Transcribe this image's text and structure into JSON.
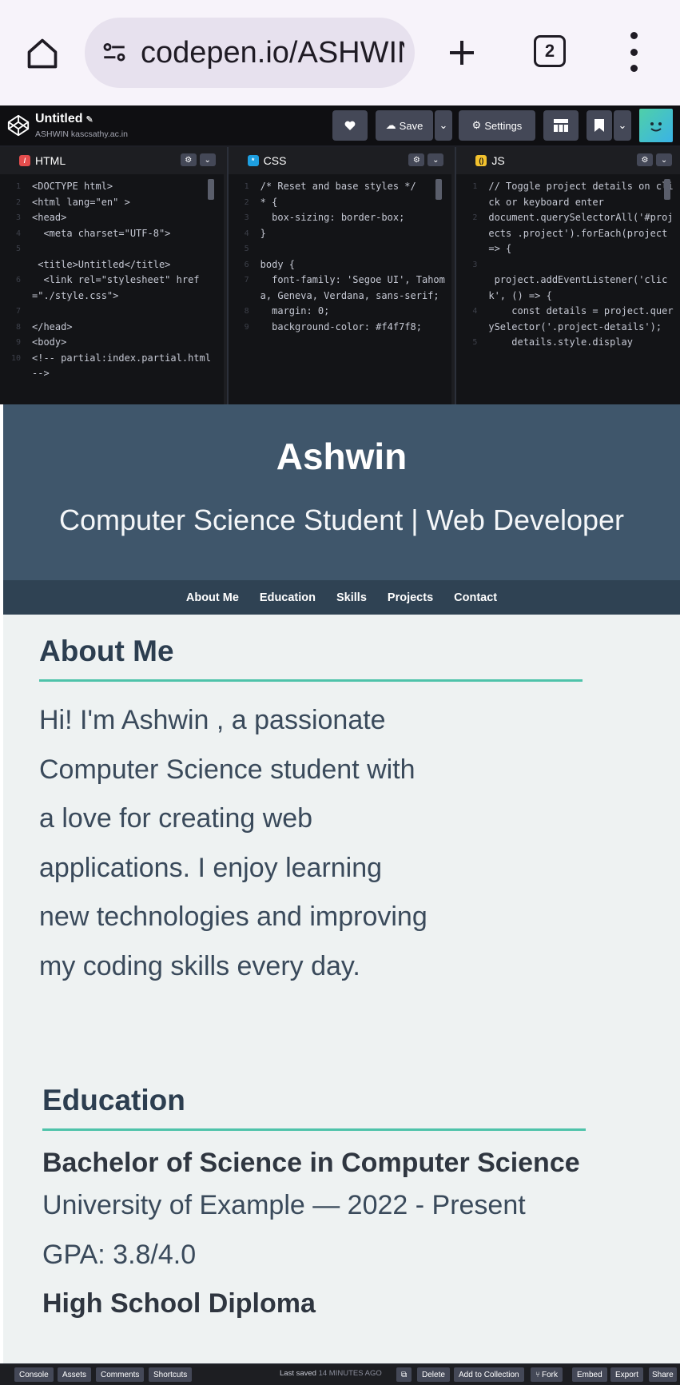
{
  "browser": {
    "url": "codepen.io/ASHWIN·",
    "tab_count": "2"
  },
  "codepen": {
    "pen_title": "Untitled",
    "user": "ASHWIN kascsathy.ac.in",
    "save_label": "Save",
    "settings_label": "Settings",
    "footer": {
      "console": "Console",
      "assets": "Assets",
      "comments": "Comments",
      "shortcuts": "Shortcuts",
      "last_saved": "Last saved",
      "last_saved_time": "14 MINUTES AGO",
      "delete": "Delete",
      "add_to_collection": "Add to Collection",
      "fork": "Fork",
      "embed": "Embed",
      "export": "Export",
      "share": "Share"
    }
  },
  "editors": {
    "html": {
      "label": "HTML",
      "lines": [
        {
          "n": "1",
          "t": "<DOCTYPE html>"
        },
        {
          "n": "2",
          "t": "<html lang=\"en\" >"
        },
        {
          "n": "3",
          "t": "<head>"
        },
        {
          "n": "4",
          "t": "  <meta charset=\"UTF-8\">"
        },
        {
          "n": "5",
          "t": ""
        },
        {
          "n": "",
          "t": " <title>Untitled</title>"
        },
        {
          "n": "6",
          "t": "  <link rel=\"stylesheet\" href=\"./style.css\">"
        },
        {
          "n": "7",
          "t": ""
        },
        {
          "n": "8",
          "t": "</head>"
        },
        {
          "n": "9",
          "t": "<body>"
        },
        {
          "n": "10",
          "t": "<!-- partial:index.partial.html -->"
        }
      ]
    },
    "css": {
      "label": "CSS",
      "lines": [
        {
          "n": "1",
          "t": "/* Reset and base styles */"
        },
        {
          "n": "2",
          "t": "* {"
        },
        {
          "n": "3",
          "t": "  box-sizing: border-box;"
        },
        {
          "n": "4",
          "t": "}"
        },
        {
          "n": "5",
          "t": ""
        },
        {
          "n": "6",
          "t": "body {"
        },
        {
          "n": "7",
          "t": "  font-family: 'Segoe UI', Tahoma, Geneva, Verdana, sans-serif;"
        },
        {
          "n": "8",
          "t": "  margin: 0;"
        },
        {
          "n": "9",
          "t": "  background-color: #f4f7f8;"
        }
      ]
    },
    "js": {
      "label": "JS",
      "lines": [
        {
          "n": "1",
          "t": "// Toggle project details on click or keyboard enter"
        },
        {
          "n": "2",
          "t": "document.querySelectorAll('#projects .project').forEach(project => {"
        },
        {
          "n": "3",
          "t": ""
        },
        {
          "n": "",
          "t": " project.addEventListener('click', () => {"
        },
        {
          "n": "4",
          "t": "    const details = project.querySelector('.project-details');"
        },
        {
          "n": "5",
          "t": "    details.style.display"
        }
      ]
    }
  },
  "site": {
    "name": "Ashwin",
    "tagline": "Computer Science Student | Web Developer",
    "nav": [
      "About Me",
      "Education",
      "Skills",
      "Projects",
      "Contact"
    ],
    "about": {
      "heading": "About Me",
      "text": "Hi! I'm Ashwin , a passionate Computer Science student with a love for creating web applications. I enjoy learning new technologies and improving my coding skills every day."
    },
    "education": {
      "heading": "Education",
      "degree": "Bachelor of Science in Computer Science",
      "school": "University of Example — 2022 - Present",
      "gpa": "GPA: 3.8/4.0",
      "degree2": "High School Diploma"
    }
  }
}
